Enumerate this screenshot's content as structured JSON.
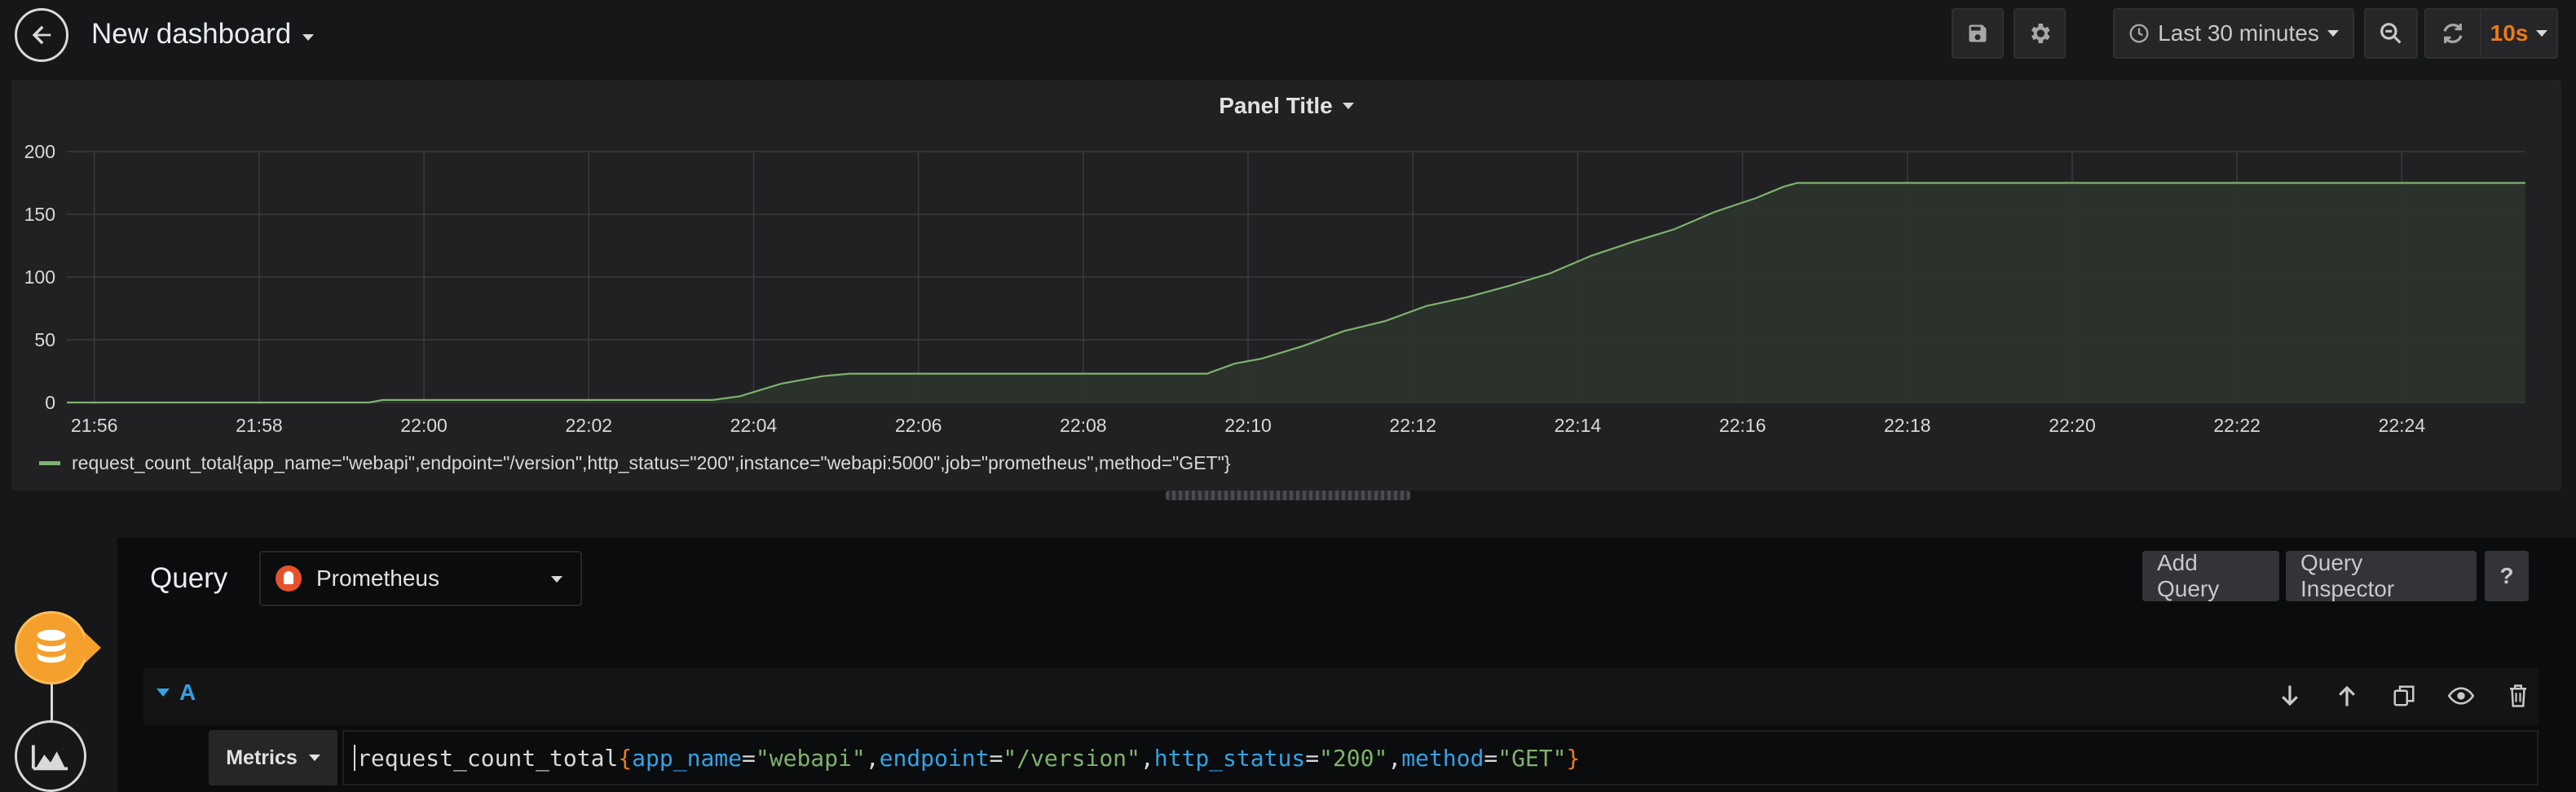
{
  "navbar": {
    "title": "New dashboard",
    "time_range": "Last 30 minutes",
    "refresh_interval": "10s"
  },
  "panel": {
    "title": "Panel Title",
    "legend": "request_count_total{app_name=\"webapi\",endpoint=\"/version\",http_status=\"200\",instance=\"webapi:5000\",job=\"prometheus\",method=\"GET\"}"
  },
  "chart_data": {
    "type": "area",
    "title": "Panel Title",
    "xlabel": "",
    "ylabel": "",
    "ylim": [
      0,
      200
    ],
    "yticks": [
      0,
      50,
      100,
      150,
      200
    ],
    "xticks": [
      "21:56",
      "21:58",
      "22:00",
      "22:02",
      "22:04",
      "22:06",
      "22:08",
      "22:10",
      "22:12",
      "22:14",
      "22:16",
      "22:18",
      "22:20",
      "22:22",
      "22:24"
    ],
    "xlim": [
      "21:55:40",
      "22:25:30"
    ],
    "grid": true,
    "legend_position": "bottom-left",
    "colors": {
      "line": "#7eb26d",
      "fill": "#2c332c"
    },
    "series": [
      {
        "name": "request_count_total{app_name=\"webapi\",endpoint=\"/version\",http_status=\"200\",instance=\"webapi:5000\",job=\"prometheus\",method=\"GET\"}",
        "points": [
          [
            "21:55:40",
            0
          ],
          [
            "21:59:20",
            0
          ],
          [
            "21:59:30",
            2
          ],
          [
            "22:03:30",
            2
          ],
          [
            "22:03:50",
            5
          ],
          [
            "22:04:20",
            15
          ],
          [
            "22:04:50",
            21
          ],
          [
            "22:05:10",
            23
          ],
          [
            "22:09:30",
            23
          ],
          [
            "22:09:50",
            31
          ],
          [
            "22:10:10",
            35
          ],
          [
            "22:10:40",
            45
          ],
          [
            "22:11:10",
            57
          ],
          [
            "22:11:40",
            65
          ],
          [
            "22:12:10",
            77
          ],
          [
            "22:12:40",
            84
          ],
          [
            "22:13:10",
            93
          ],
          [
            "22:13:40",
            103
          ],
          [
            "22:14:10",
            117
          ],
          [
            "22:14:40",
            128
          ],
          [
            "22:15:10",
            138
          ],
          [
            "22:15:40",
            152
          ],
          [
            "22:16:10",
            163
          ],
          [
            "22:16:30",
            172
          ],
          [
            "22:16:40",
            175
          ],
          [
            "22:25:30",
            175
          ]
        ]
      }
    ]
  },
  "editor": {
    "label": "Query",
    "datasource": "Prometheus",
    "add_query": "Add Query",
    "query_inspector": "Query Inspector",
    "help": "?",
    "query_row": {
      "ref_id": "A",
      "metrics_label": "Metrics",
      "expr_parts": {
        "name": "request_count_total",
        "open": "{",
        "k1": "app_name",
        "v1": "\"webapi\"",
        "k2": "endpoint",
        "v2": "\"/version\"",
        "k3": "http_status",
        "v3": "\"200\"",
        "k4": "method",
        "v4": "\"GET\"",
        "close": "}",
        "eq": "=",
        "comma": ","
      }
    }
  },
  "icons": {
    "back": "arrow-left-icon",
    "save": "save-icon",
    "settings": "gear-icon",
    "clock": "clock-icon",
    "zoom_out": "zoom-out-icon",
    "refresh": "refresh-icon",
    "datasource": "prometheus-icon",
    "move_down": "arrow-down-icon",
    "move_up": "arrow-up-icon",
    "duplicate": "copy-icon",
    "toggle": "eye-icon",
    "remove": "trash-icon",
    "queries_tab": "database-icon",
    "visualization_tab": "area-chart-icon"
  }
}
